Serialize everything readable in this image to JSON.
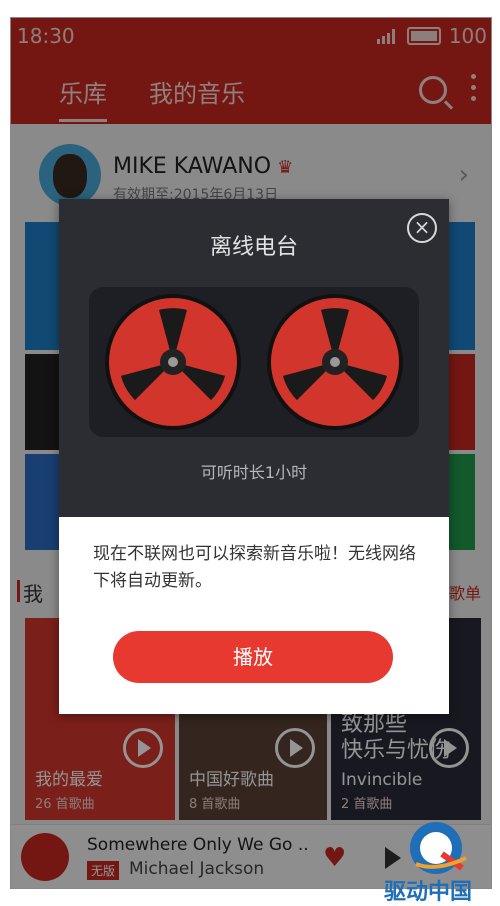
{
  "status": {
    "time": "18:30",
    "battery": "100"
  },
  "header": {
    "tabs": [
      {
        "label": "乐库"
      },
      {
        "label": "我的音乐"
      }
    ]
  },
  "profile": {
    "name": "MIKE KAWANO",
    "validity": "有效期至:2015年6月13日"
  },
  "section": {
    "label": "我",
    "more_link": "歌单"
  },
  "cards": [
    {
      "title": "我的最爱",
      "count": "26 首歌曲"
    },
    {
      "title": "中国好歌曲",
      "count": "8 首歌曲"
    },
    {
      "title": "Invincible",
      "count": "2 首歌曲",
      "big_text_lines": [
        "致那些",
        "快乐与忧伤"
      ]
    }
  ],
  "player": {
    "song": "Somewhere Only We Go ..",
    "badge": "无版",
    "artist": "Michael Jackson"
  },
  "dialog": {
    "title": "离线电台",
    "duration": "可听时长1小时",
    "message": "现在不联网也可以探索新音乐啦！无线网络下将自动更新。",
    "play_label": "播放"
  },
  "watermark": {
    "text": "驱动中国"
  },
  "colors": {
    "primary_red": "#c8281f",
    "button_red": "#e7392f",
    "dialog_dark": "#2b2d33"
  },
  "icons": [
    "search-icon",
    "more-icon",
    "crown-icon",
    "chevron-right-icon",
    "close-icon",
    "reel-icon",
    "play-icon",
    "heart-icon",
    "next-icon"
  ]
}
